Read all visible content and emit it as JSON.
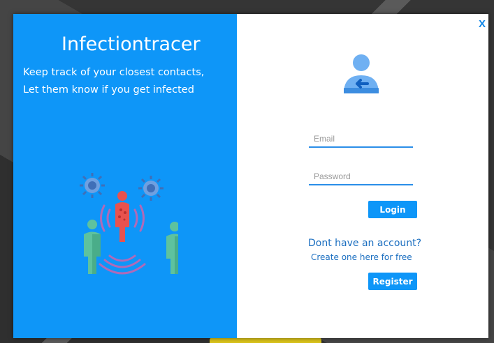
{
  "app": {
    "title": "Infectiontracer"
  },
  "tagline": {
    "line1": "Keep track of your closest contacts,",
    "line2": "Let them know if you get infected"
  },
  "window": {
    "close_label": "X"
  },
  "form": {
    "email_placeholder": "Email",
    "password_placeholder": "Password",
    "login_label": "Login",
    "no_account_prompt": "Dont have an account?",
    "create_link": "Create one here for free",
    "register_label": "Register"
  },
  "icons": {
    "illustration": "infection-contacts-illustration",
    "user": "user-login-arrow-icon"
  },
  "colors": {
    "accent": "#0e96f8",
    "infected": "#e8524e",
    "healthy": "#5ec29e",
    "virus": "#3f6fb8"
  }
}
